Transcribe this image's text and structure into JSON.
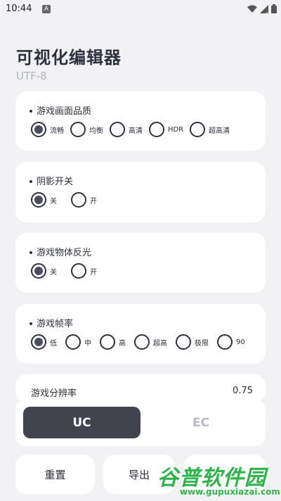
{
  "status_bar": {
    "time": "10:44",
    "notif_letter": "A"
  },
  "header": {
    "title": "可视化编辑器",
    "subtitle": "UTF-8"
  },
  "sections": [
    {
      "label": "游戏画面品质",
      "options": [
        "流畅",
        "均衡",
        "高清",
        "HDR",
        "超高清"
      ],
      "selected": 0
    },
    {
      "label": "阴影开关",
      "options": [
        "关",
        "开"
      ],
      "selected": 0
    },
    {
      "label": "游戏物体反光",
      "options": [
        "关",
        "开"
      ],
      "selected": 0
    },
    {
      "label": "游戏帧率",
      "options": [
        "低",
        "中",
        "高",
        "超高",
        "极限",
        "90"
      ],
      "selected": 0
    }
  ],
  "partial_section": {
    "label": "游戏分辨率",
    "value": "0.75"
  },
  "mode_toggle": {
    "uc": "UC",
    "ec": "EC",
    "selected": "UC"
  },
  "bottom_buttons": {
    "reset": "重置",
    "export": "导出"
  },
  "watermark": {
    "main": "谷普软件园",
    "url": "www.gupuxiazai.com"
  },
  "colors": {
    "background": "#f2f2f4",
    "accent": "#41434f",
    "card": "#ffffff",
    "watermark": "#2fb34a"
  }
}
